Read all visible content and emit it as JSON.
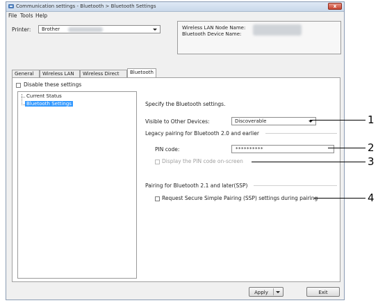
{
  "window": {
    "title": "Communication settings - Bluetooth > Bluetooth Settings",
    "close_label": "x"
  },
  "menu": {
    "file": "File",
    "tools": "Tools",
    "help": "Help"
  },
  "printer": {
    "label": "Printer:",
    "value": "Brother"
  },
  "info": {
    "wlan_node_label": "Wireless LAN Node Name:",
    "bt_device_label": "Bluetooth Device Name:"
  },
  "tabs": [
    {
      "label": "General"
    },
    {
      "label": "Wireless LAN"
    },
    {
      "label": "Wireless Direct"
    },
    {
      "label": "Bluetooth"
    }
  ],
  "disable_settings": "Disable these settings",
  "tree": {
    "items": [
      "Current Status",
      "Bluetooth Settings"
    ]
  },
  "settings": {
    "heading": "Specify the Bluetooth settings.",
    "visible_label": "Visible to Other Devices:",
    "visible_value": "Discoverable",
    "legacy_group": "Legacy pairing for Bluetooth 2.0 and earlier",
    "pin_label": "PIN code:",
    "pin_value": "**********",
    "display_pin": "Display the PIN code on-screen",
    "ssp_group": "Pairing for Bluetooth 2.1 and later(SSP)",
    "ssp_request": "Request Secure Simple Pairing (SSP) settings during pairing"
  },
  "buttons": {
    "apply": "Apply",
    "exit": "Exit"
  },
  "callouts": [
    "1",
    "2",
    "3",
    "4"
  ]
}
